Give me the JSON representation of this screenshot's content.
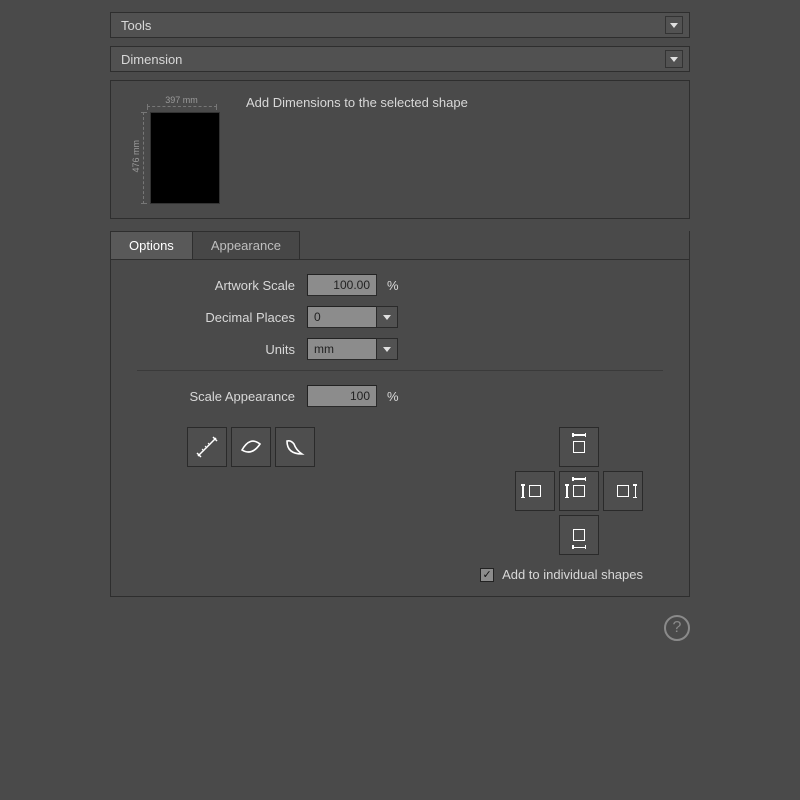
{
  "headers": {
    "tools": "Tools",
    "dimension": "Dimension"
  },
  "preview": {
    "width_label": "397 mm",
    "height_label": "476 mm",
    "caption": "Add Dimensions to the selected shape"
  },
  "tabs": {
    "options": "Options",
    "appearance": "Appearance"
  },
  "options": {
    "artwork_scale_label": "Artwork Scale",
    "artwork_scale_value": "100.00",
    "artwork_scale_unit": "%",
    "decimal_places_label": "Decimal Places",
    "decimal_places_value": "0",
    "units_label": "Units",
    "units_value": "mm",
    "scale_appearance_label": "Scale Appearance",
    "scale_appearance_value": "100",
    "scale_appearance_unit": "%",
    "add_individual_label": "Add to individual shapes",
    "add_individual_checked": true
  },
  "icons": {
    "measure": "measure-line-icon",
    "leaf": "curve-leaf-icon",
    "arc": "arc-icon",
    "place_top": "dimension-top-icon",
    "place_left": "dimension-left-icon",
    "place_center": "dimension-all-icon",
    "place_right": "dimension-right-icon",
    "place_bottom": "dimension-bottom-icon"
  }
}
